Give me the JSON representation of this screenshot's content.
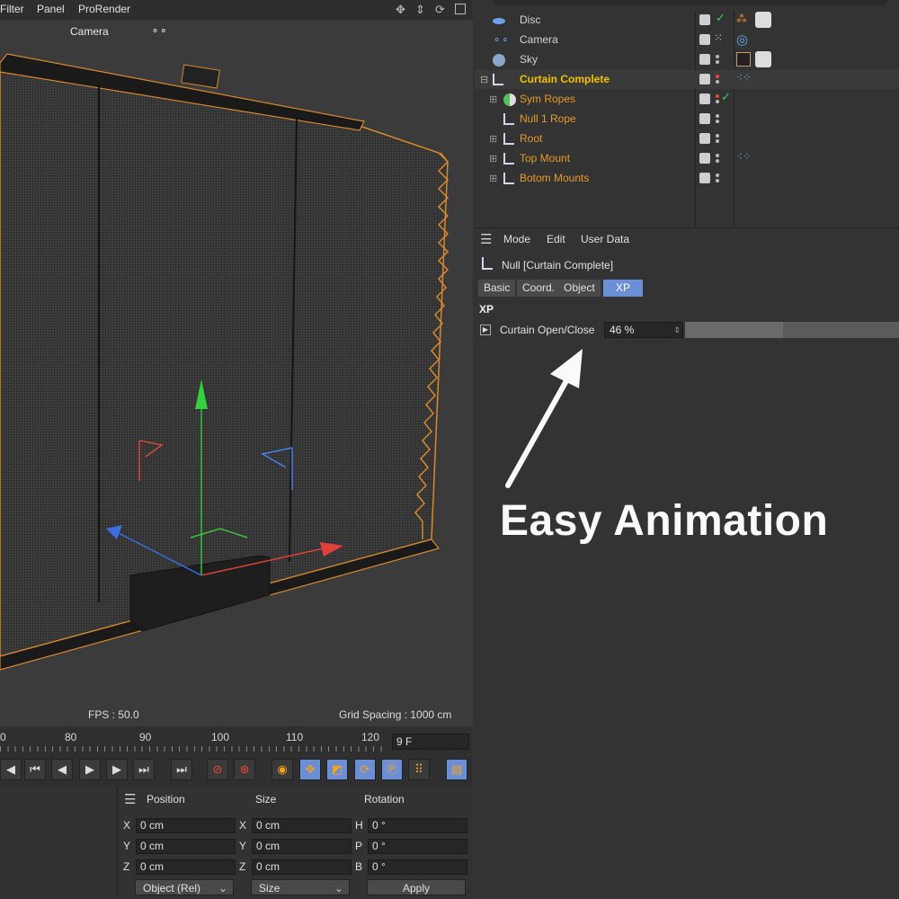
{
  "viewport_menu": {
    "items": [
      "Filter",
      "Panel",
      "ProRender"
    ]
  },
  "viewport": {
    "camera_label": "Camera",
    "fps": "FPS : 50.0",
    "grid_spacing": "Grid Spacing : 1000 cm"
  },
  "timeline": {
    "ticks": [
      "0",
      "80",
      "90",
      "100",
      "110",
      "120"
    ],
    "frame_field": "9 F"
  },
  "objects": [
    {
      "name": "Disc",
      "color": "#d6d6d6"
    },
    {
      "name": "Camera",
      "color": "#d6d6d6"
    },
    {
      "name": "Sky",
      "color": "#d6d6d6"
    },
    {
      "name": "Curtain Complete",
      "color": "#f2c200"
    },
    {
      "name": "Sym Ropes",
      "color": "#e59a2b"
    },
    {
      "name": "Null 1 Rope",
      "color": "#e59a2b"
    },
    {
      "name": "Root",
      "color": "#e59a2b"
    },
    {
      "name": "Top Mount",
      "color": "#e59a2b"
    },
    {
      "name": "Botom Mounts",
      "color": "#e59a2b"
    }
  ],
  "attr": {
    "menu": [
      "Mode",
      "Edit",
      "User Data"
    ],
    "object_title": "Null [Curtain Complete]",
    "tabs": [
      "Basic",
      "Coord.",
      "Object",
      "XP"
    ],
    "section": "XP",
    "param_label": "Curtain Open/Close",
    "param_value": "46 %",
    "param_fraction": 0.46
  },
  "caption": "Easy Animation",
  "coord": {
    "headers": [
      "Position",
      "Size",
      "Rotation"
    ],
    "pos_axes": [
      "X",
      "Y",
      "Z"
    ],
    "rot_axes": [
      "H",
      "P",
      "B"
    ],
    "position": [
      "0 cm",
      "0 cm",
      "0 cm"
    ],
    "size": [
      "0 cm",
      "0 cm",
      "0 cm"
    ],
    "rotation": [
      "0 °",
      "0 °",
      "0 °"
    ],
    "mode_dropdown": "Object (Rel)",
    "size_dropdown": "Size",
    "apply_label": "Apply"
  },
  "colors": {
    "accent": "#6b8fd6",
    "selected_object": "#f2c200",
    "child_object": "#e59a2b",
    "curtain_outline": "#d6892d"
  }
}
